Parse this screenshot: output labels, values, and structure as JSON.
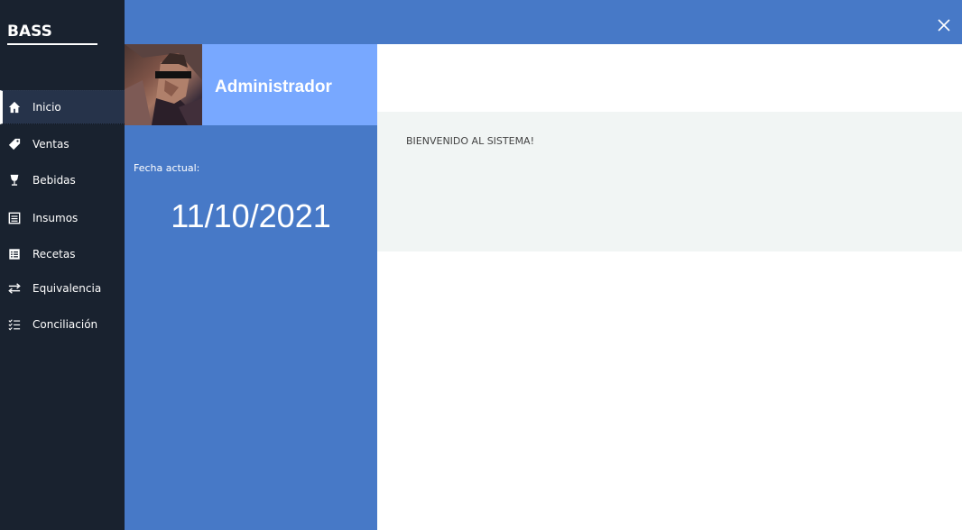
{
  "app": {
    "brand": "BASS"
  },
  "sidebar": {
    "items": [
      {
        "label": "Inicio",
        "icon": "home-icon",
        "active": true
      },
      {
        "label": "Ventas",
        "icon": "tag-icon",
        "active": false
      },
      {
        "label": "Bebidas",
        "icon": "wine-glass-icon",
        "active": false
      },
      {
        "label": "Insumos",
        "icon": "list-box-icon",
        "active": false
      },
      {
        "label": "Recetas",
        "icon": "recipe-list-icon",
        "active": false
      },
      {
        "label": "Equivalencia",
        "icon": "swap-arrows-icon",
        "active": false
      },
      {
        "label": "Conciliación",
        "icon": "checklist-icon",
        "active": false
      }
    ]
  },
  "user": {
    "name": "Administrador"
  },
  "date": {
    "label": "Fecha actual:",
    "value": "11/10/2021"
  },
  "main": {
    "welcome": "BIENVENIDO AL SISTEMA!"
  },
  "colors": {
    "sidebar_bg": "#19222f",
    "accent_blue": "#4779c7",
    "user_header_bg": "#78a8ff",
    "welcome_bg": "#f1f5f4"
  }
}
